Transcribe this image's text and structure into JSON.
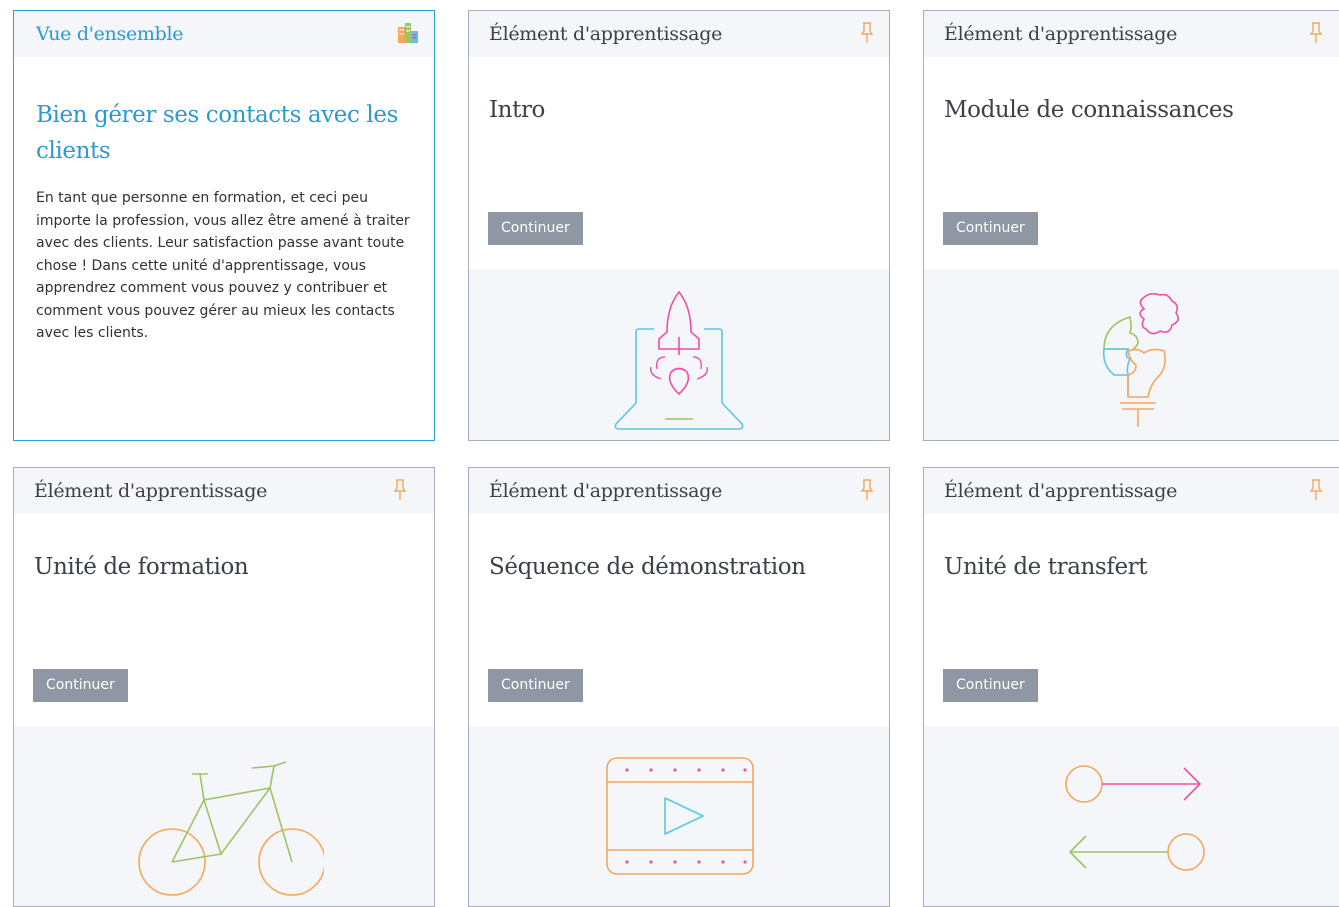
{
  "overview": {
    "header": "Vue d'ensemble",
    "header_icon": "buildings-icon",
    "title": "Bien gérer ses contacts avec les clients",
    "description": "En tant que personne en formation, et ceci peu importe la profession, vous allez être amené à traiter avec des clients. Leur satisfaction passe avant toute chose ! Dans cette unité d'apprentissage, vous apprendrez comment vous pouvez y contribuer et comment vous pouvez gérer au mieux les contacts avec les clients."
  },
  "cards": [
    {
      "header": "Élément d'apprentissage",
      "title": "Intro",
      "button": "Continuer",
      "icon": "rocket-laptop-icon"
    },
    {
      "header": "Élément d'apprentissage",
      "title": "Module de connaissances",
      "button": "Continuer",
      "icon": "puzzle-bulb-icon"
    },
    {
      "header": "Élément d'apprentissage",
      "title": "Unité de formation",
      "button": "Continuer",
      "icon": "bicycle-icon"
    },
    {
      "header": "Élément d'apprentissage",
      "title": "Séquence de démonstration",
      "button": "Continuer",
      "icon": "video-film-icon"
    },
    {
      "header": "Élément d'apprentissage",
      "title": "Unité de transfert",
      "button": "Continuer",
      "icon": "transfer-arrows-icon"
    }
  ],
  "pin_icon": "pin-icon",
  "colors": {
    "accent_blue": "#2aa0d8",
    "button_gray": "#8f96a4",
    "pin_orange": "#f4a85a",
    "illus_pink": "#ef4fa6",
    "illus_cyan": "#5bc6e8",
    "illus_green": "#9cc464",
    "illus_orange": "#f4a85a"
  }
}
